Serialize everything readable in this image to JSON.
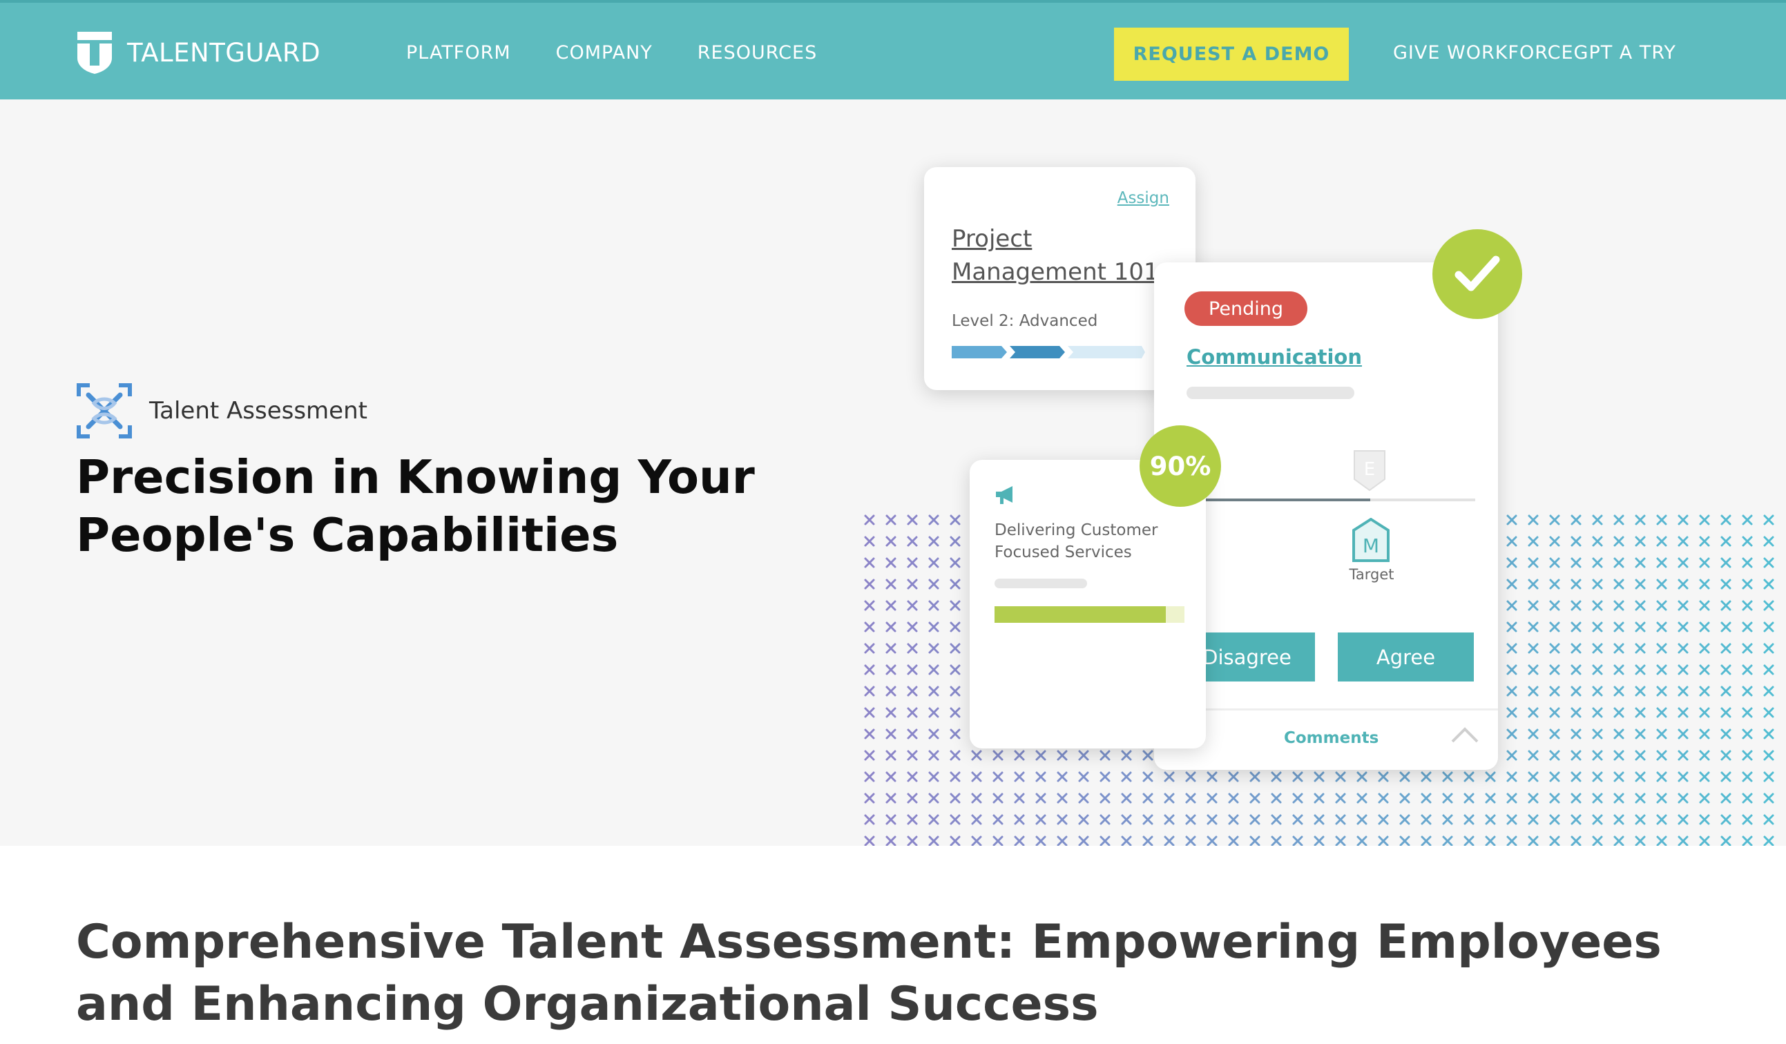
{
  "nav": {
    "brand": "TALENTGUARD",
    "links": [
      "PLATFORM",
      "COMPANY",
      "RESOURCES"
    ],
    "demo_button": "REQUEST A DEMO",
    "gpt_link": "GIVE WORKFORCEGPT A TRY",
    "colors": {
      "bar": "#5ebcbf",
      "demo_bg": "#eee84a",
      "demo_text": "#4aa8ac"
    }
  },
  "hero": {
    "badge_icon": "talent-assessment-icon",
    "badge_label": "Talent Assessment",
    "title": "Precision in Knowing Your People's Capabilities",
    "project_card": {
      "assign": "Assign",
      "title": "Project Management 101",
      "level": "Level 2: Advanced",
      "level_progress": 2,
      "level_total": 3
    },
    "competency_card": {
      "status": "Pending",
      "competency": "Communication",
      "marker_expected": "E",
      "marker_target": "M",
      "target_label": "Target",
      "disagree": "Disagree",
      "agree": "Agree",
      "comments": "Comments"
    },
    "service_card": {
      "icon": "megaphone-icon",
      "title": "Delivering Customer Focused Services",
      "percent_label": "90%",
      "progress": 0.9
    },
    "colors": {
      "accent": "#4fb3b6",
      "green": "#b2cf45",
      "pending": "#d9574f"
    }
  },
  "section": {
    "title": "Comprehensive Talent Assessment: Empowering Employees and Enhancing Organizational Success"
  }
}
